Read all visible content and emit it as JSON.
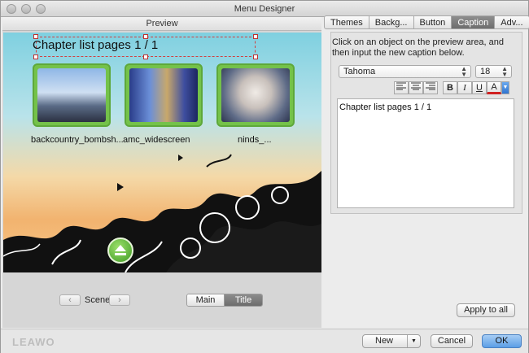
{
  "window": {
    "title": "Menu Designer"
  },
  "preview": {
    "header": "Preview",
    "caption": "Chapter list pages 1 / 1",
    "thumbnails": [
      {
        "label": "backcountry_bombsh..."
      },
      {
        "label": "amc_widescreen"
      },
      {
        "label": "ninds_..."
      }
    ],
    "scene_label": "Scene",
    "segments": {
      "main": "Main",
      "title": "Title"
    }
  },
  "tabs": [
    "Themes",
    "Backg...",
    "Button",
    "Caption",
    "Adv..."
  ],
  "active_tab": "Caption",
  "caption_panel": {
    "instructions": "Click on an object on the preview area, and then input the new caption below.",
    "font_family": "Tahoma",
    "font_size": "18",
    "text_value": "Chapter list pages 1 / 1",
    "bold": "B",
    "italic": "I",
    "underline": "U",
    "color_glyph": "A",
    "apply_all": "Apply to all"
  },
  "footer": {
    "logo": "LEAWO",
    "new_label": "New",
    "cancel_label": "Cancel",
    "ok_label": "OK"
  },
  "colors": {
    "accent": "#5b9ee6",
    "thumb_frame": "#74c24a",
    "text_color_swatch": "#d02020"
  }
}
